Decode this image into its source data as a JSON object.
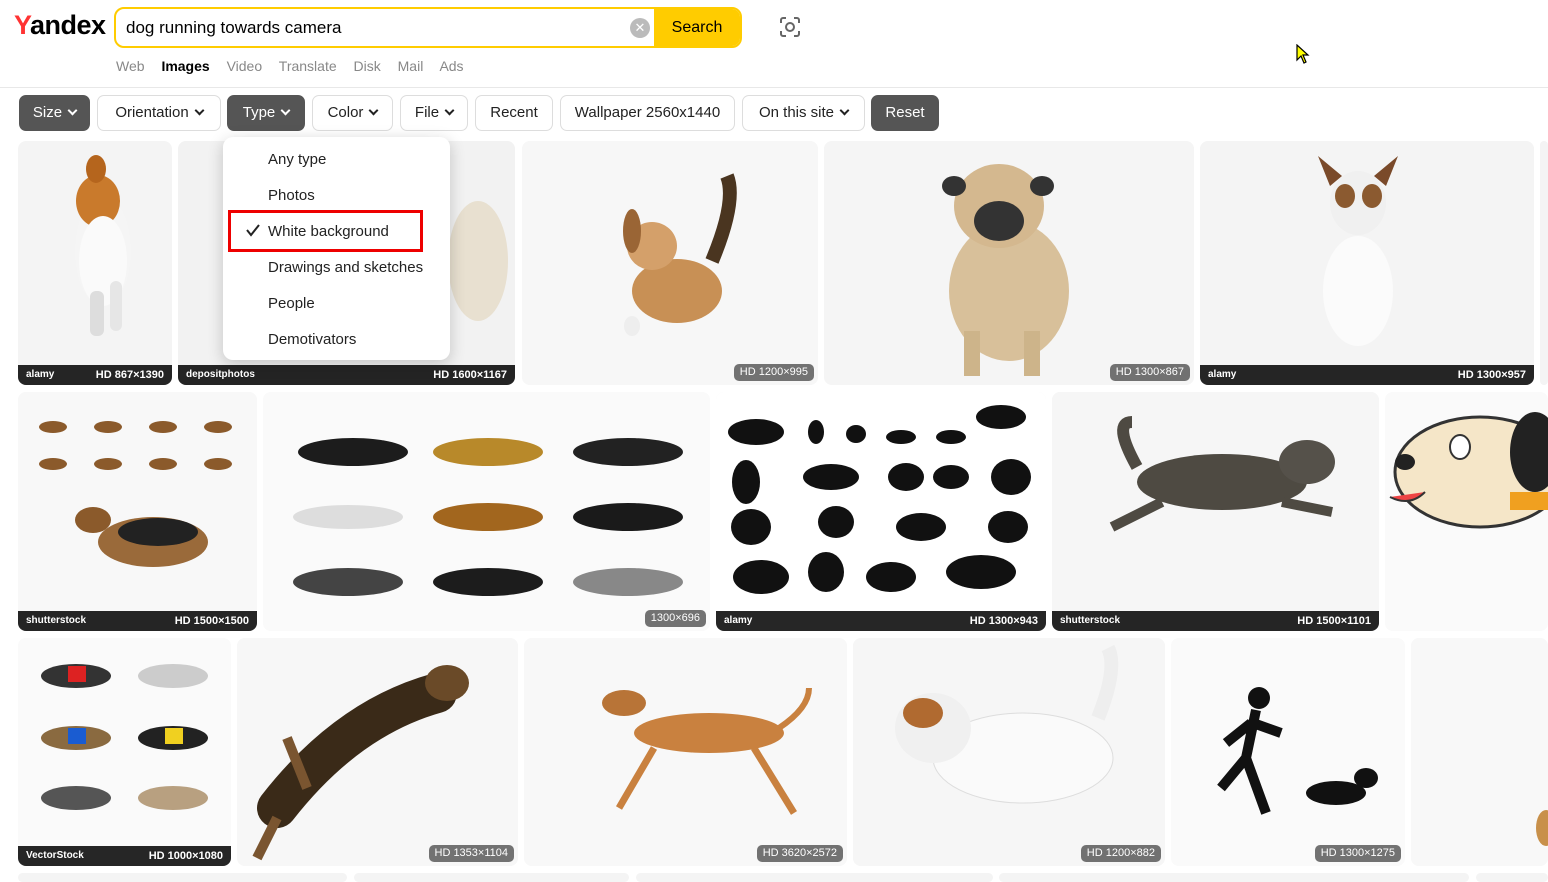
{
  "header": {
    "logo": "Yandex",
    "search_value": "dog running towards camera",
    "search_button": "Search",
    "nav": [
      "Web",
      "Images",
      "Video",
      "Translate",
      "Disk",
      "Mail",
      "Ads"
    ]
  },
  "filters": {
    "size": "Size",
    "orientation": "Orientation",
    "type": "Type",
    "color": "Color",
    "file": "File",
    "recent": "Recent",
    "wallpaper": "Wallpaper 2560x1440",
    "on_this_site": "On this site",
    "reset": "Reset"
  },
  "type_menu": {
    "items": [
      "Any type",
      "Photos",
      "White background",
      "Drawings and sketches",
      "People",
      "Demotivators"
    ],
    "selected": "White background"
  },
  "results": {
    "row1": [
      {
        "source": "alamy",
        "size": "HD 867×1390"
      },
      {
        "source": "depositphotos",
        "size": "HD 1600×1167"
      },
      {
        "size": "HD 1200×995"
      },
      {
        "size": "HD 1300×867"
      },
      {
        "source": "alamy",
        "size": "HD 1300×957"
      }
    ],
    "row2": [
      {
        "source": "shutterstock",
        "size": "HD 1500×1500"
      },
      {
        "size": "1300×696"
      },
      {
        "source": "alamy",
        "size": "HD 1300×943"
      },
      {
        "source": "shutterstock",
        "size": "HD 1500×1101"
      }
    ],
    "row3": [
      {
        "source": "VectorStock",
        "size": "HD 1000×1080"
      },
      {
        "size": "HD 1353×1104"
      },
      {
        "size": "HD 3620×2572"
      },
      {
        "size": "HD 1200×882"
      },
      {
        "size": "HD 1300×1275"
      }
    ]
  },
  "colors": {
    "accent": "#ffcc00",
    "logo_red": "#ff3333",
    "highlight": "#e00000"
  }
}
